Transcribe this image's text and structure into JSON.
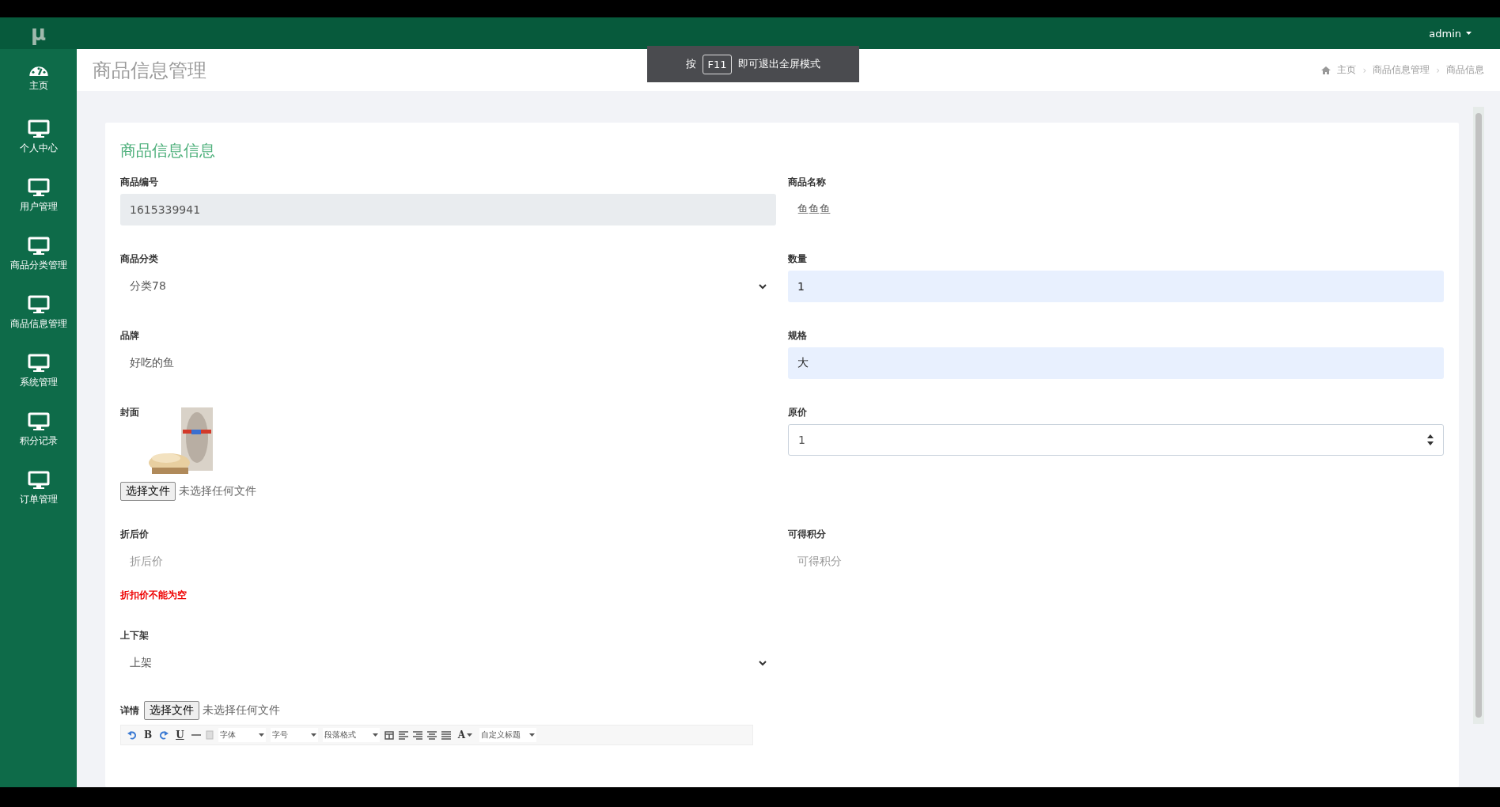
{
  "topbar": {
    "logo": "μ",
    "user": "admin"
  },
  "sidebar": {
    "items": [
      {
        "label": "主页",
        "selected": false
      },
      {
        "label": "个人中心",
        "selected": false
      },
      {
        "label": "用户管理",
        "selected": false
      },
      {
        "label": "商品分类管理",
        "selected": false
      },
      {
        "label": "商品信息管理",
        "selected": false
      },
      {
        "label": "系统管理",
        "selected": false
      },
      {
        "label": "积分记录",
        "selected": false
      },
      {
        "label": "订单管理",
        "selected": false
      }
    ]
  },
  "page_header": {
    "title": "商品信息管理",
    "breadcrumb": [
      "主页",
      "商品信息管理",
      "商品信息"
    ],
    "separator": "›"
  },
  "fullscreen_toast": {
    "prefix": "按",
    "key": "F11",
    "text": "即可退出全屏模式"
  },
  "form": {
    "title": "商品信息信息",
    "fields": [
      {
        "label": "商品编号",
        "kind": "readonly",
        "value": "1615339941"
      },
      {
        "label": "商品名称",
        "kind": "text",
        "value": "鱼鱼鱼",
        "autofilled": false
      },
      {
        "label": "商品分类",
        "kind": "select",
        "value": "分类78"
      },
      {
        "label": "数量",
        "kind": "text",
        "value": "1",
        "autofilled": true
      },
      {
        "label": "品牌",
        "kind": "text",
        "value": "好吃的鱼",
        "autofilled": false
      },
      {
        "label": "规格",
        "kind": "text",
        "value": "大",
        "autofilled": true
      },
      {
        "label": "封面",
        "file_button": "选择文件",
        "file_status": "未选择任何文件"
      },
      {
        "label": "原价",
        "kind": "number",
        "value": "1"
      },
      {
        "label": "折后价",
        "kind": "text",
        "placeholder": "折后价",
        "error": "折扣价不能为空",
        "autofilled": false
      },
      {
        "label": "可得积分",
        "kind": "text",
        "placeholder": "可得积分",
        "autofilled": false
      },
      {
        "label": "上下架",
        "kind": "select",
        "value": "上架"
      }
    ]
  },
  "detail": {
    "label": "详情",
    "file_button": "选择文件",
    "file_status": "未选择任何文件",
    "toolbar": [
      {
        "kind": "icon"
      },
      {
        "kind": "text",
        "label": "B"
      },
      {
        "kind": "icon"
      },
      {
        "kind": "text",
        "label": "U"
      },
      {
        "kind": "icon"
      },
      {
        "kind": "icon"
      },
      {
        "kind": "dropdown",
        "label": "字体"
      },
      {
        "kind": "dropdown",
        "label": "字号"
      },
      {
        "kind": "dropdown",
        "label": "段落格式"
      },
      {
        "kind": "icon"
      },
      {
        "kind": "icon"
      },
      {
        "kind": "icon"
      },
      {
        "kind": "icon"
      },
      {
        "kind": "icon"
      },
      {
        "kind": "color",
        "label": "A"
      },
      {
        "kind": "dropdown",
        "label": "自定义标题"
      }
    ]
  }
}
